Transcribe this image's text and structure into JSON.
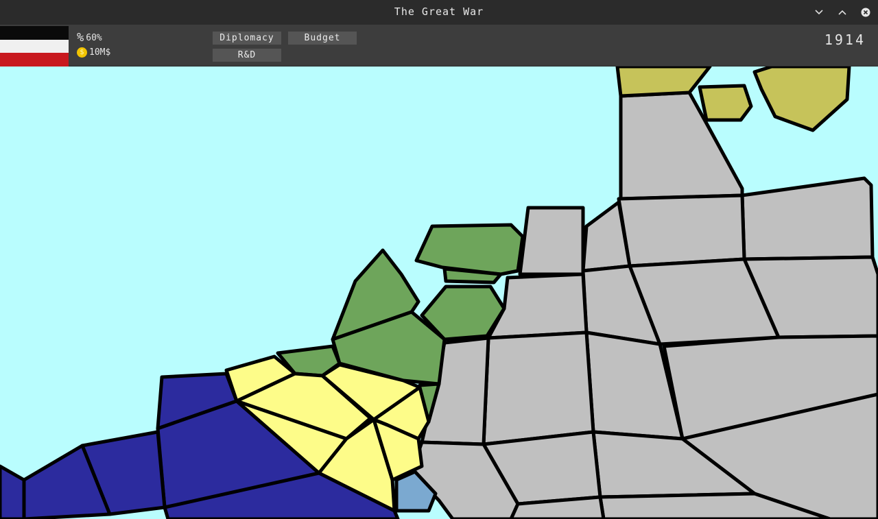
{
  "window": {
    "title": "The Great War"
  },
  "hud": {
    "approval_icon": "%",
    "approval": "60%",
    "money": "10M$",
    "coin_icon": "$",
    "year": "1914",
    "flag_colors": [
      "#0a0a0a",
      "#f0f0f0",
      "#c8181e"
    ],
    "buttons": {
      "diplomacy": "Diplomacy",
      "budget": "Budget",
      "rnd": "R&D"
    }
  },
  "map": {
    "sea_color": "#b9fdfe",
    "country_colors": {
      "grey": "#c0c0c0",
      "green": "#6ea55b",
      "olive": "#c6c35a",
      "yellow": "#fdfc89",
      "navy": "#2c2b9e",
      "blue": "#7ba9d0"
    }
  }
}
